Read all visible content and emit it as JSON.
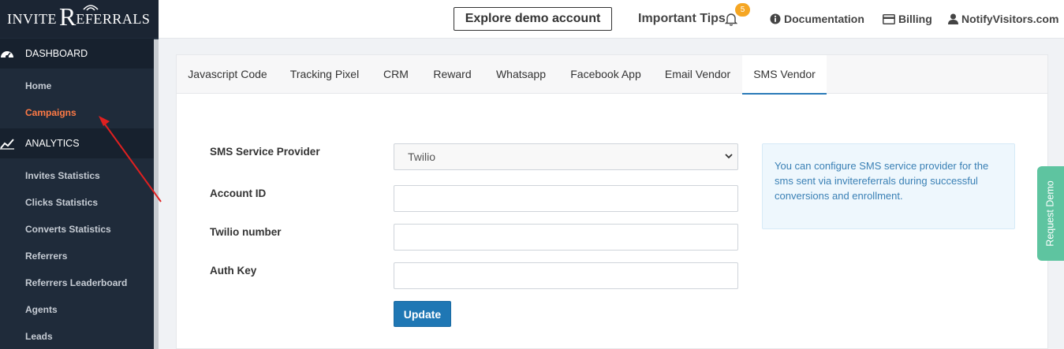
{
  "logo": {
    "part1": "INVITE",
    "part2": "R",
    "part3": "EFERRALS"
  },
  "sidebar": {
    "sections": [
      {
        "label": "DASHBOARD",
        "icon": "dashboard-icon"
      },
      {
        "label": "ANALYTICS",
        "icon": "chart-line-icon"
      }
    ],
    "items": [
      {
        "label": "Home"
      },
      {
        "label": "Campaigns",
        "active": true
      },
      {
        "label": "Invites Statistics"
      },
      {
        "label": "Clicks Statistics"
      },
      {
        "label": "Converts Statistics"
      },
      {
        "label": "Referrers"
      },
      {
        "label": "Referrers Leaderboard"
      },
      {
        "label": "Agents"
      },
      {
        "label": "Leads"
      }
    ],
    "active_color": "#ff7a45"
  },
  "header": {
    "demo_button": "Explore demo account",
    "tips": "Important Tips",
    "tips_badge": "5",
    "documentation": "Documentation",
    "billing": "Billing",
    "account": "NotifyVisitors.com"
  },
  "tabs": [
    {
      "label": "Javascript Code"
    },
    {
      "label": "Tracking Pixel"
    },
    {
      "label": "CRM"
    },
    {
      "label": "Reward"
    },
    {
      "label": "Whatsapp"
    },
    {
      "label": "Facebook App"
    },
    {
      "label": "Email Vendor"
    },
    {
      "label": "SMS Vendor",
      "active": true
    }
  ],
  "form": {
    "provider_label": "SMS Service Provider",
    "provider_value": "Twilio",
    "account_id_label": "Account ID",
    "account_id_value": "",
    "twilio_number_label": "Twilio number",
    "twilio_number_value": "",
    "auth_key_label": "Auth Key",
    "auth_key_value": "",
    "update_button": "Update"
  },
  "info_text": "You can configure SMS service provider for the sms sent via invitereferrals during successful conversions and enrollment.",
  "request_demo": "Request Demo",
  "colors": {
    "primary": "#1f77b4",
    "sidebar": "#1f2b3a",
    "badge": "#f5a623",
    "request_demo": "#5ec4a0",
    "annotation": "#e02020"
  }
}
